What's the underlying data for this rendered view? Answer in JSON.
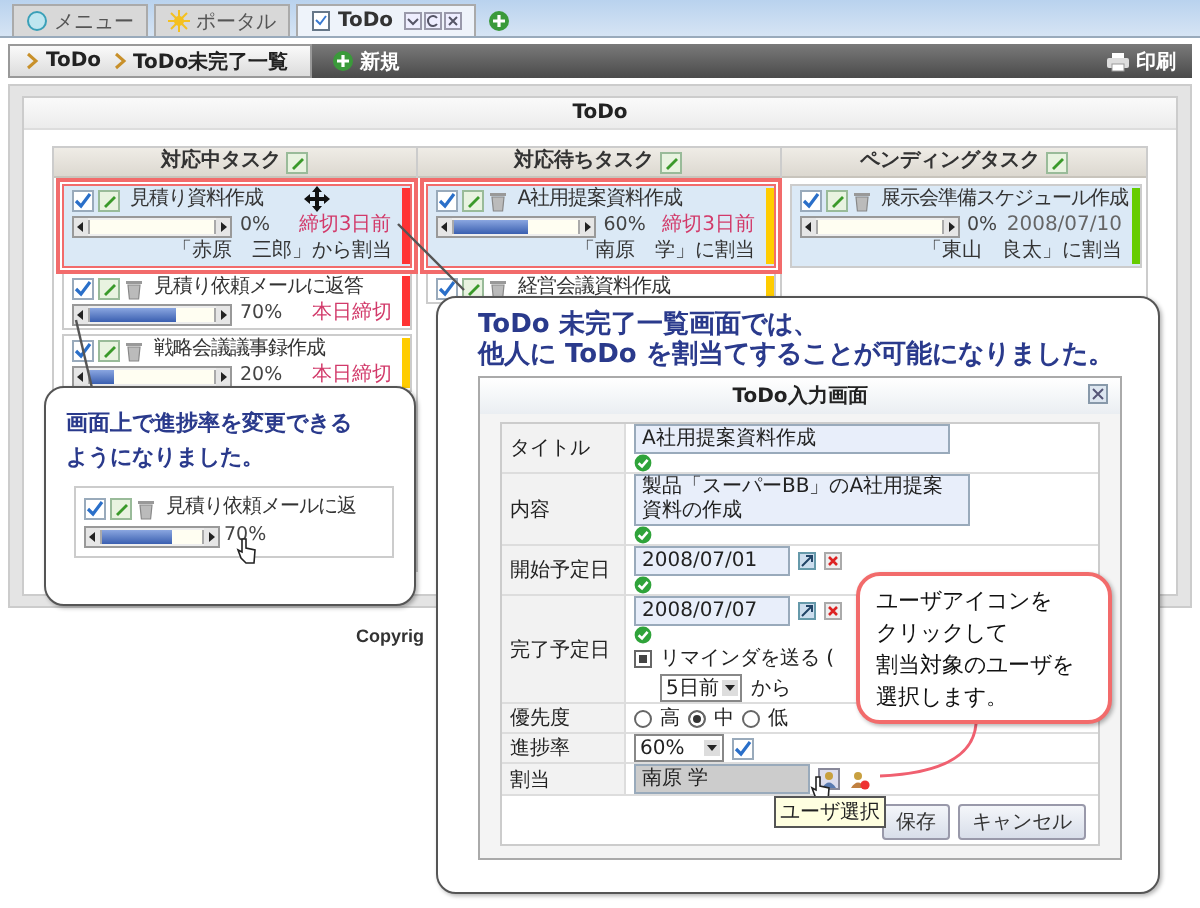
{
  "app_tabs": [
    {
      "label": "メニュー",
      "kind": "menu",
      "selected": false
    },
    {
      "label": "ポータル",
      "kind": "portal",
      "selected": false
    },
    {
      "label": "ToDo",
      "kind": "todo",
      "selected": true
    }
  ],
  "toolbar": {
    "breadcrumb": [
      "ToDo",
      "ToDo未完了一覧"
    ],
    "new_button": "新規",
    "print_button": "印刷"
  },
  "panel": {
    "title": "ToDo",
    "columns": [
      {
        "title": "対応中タスク",
        "tasks": [
          {
            "title": "見積り資料作成",
            "can_delete": false,
            "level": 0,
            "progress": "0%",
            "due": "締切3日前",
            "urgent": true,
            "assignment": "「赤原　三郎」から割当",
            "color": "#ff3333",
            "selected": true,
            "emphasized": true
          },
          {
            "title": "見積り依頼メールに返答",
            "can_delete": true,
            "level": 0.7,
            "progress": "70%",
            "due": "本日締切",
            "urgent": true,
            "color": "#ff3333",
            "selected": false,
            "emphasized": false
          },
          {
            "title": "戦略会議議事録作成",
            "can_delete": true,
            "level": 0.2,
            "progress": "20%",
            "due": "本日締切",
            "urgent": true,
            "color": "#ffcc00",
            "selected": false,
            "emphasized": false
          }
        ]
      },
      {
        "title": "対応待ちタスク",
        "tasks": [
          {
            "title": "A社用提案資料作成",
            "can_delete": true,
            "level": 0.6,
            "progress": "60%",
            "due": "締切3日前",
            "urgent": true,
            "assignment": "「南原　学」に割当",
            "color": "#ffcc00",
            "selected": true,
            "emphasized": true
          },
          {
            "title": "経営会議資料作成",
            "can_delete": true,
            "color": "#ffcc00",
            "selected": false,
            "emphasized": false
          }
        ]
      },
      {
        "title": "ペンディングタスク",
        "tasks": [
          {
            "title": "展示会準備スケジュール作成",
            "can_delete": true,
            "level": 0,
            "progress": "0%",
            "due": "2008/07/10",
            "urgent": false,
            "assignment": "「東山　良太」に割当",
            "color": "#66cc00",
            "selected": true,
            "emphasized": false
          }
        ]
      }
    ]
  },
  "footer": {
    "copyright": "Copyrig"
  },
  "callout_progress": {
    "lines": [
      "画面上で進捗率を変更できる",
      "ようになりました。"
    ],
    "sample": {
      "title": "見積り依頼メールに返",
      "level": 0.7,
      "progress": "70%"
    }
  },
  "callout_assign": {
    "lines": [
      "ToDo 未完了一覧画面では、",
      "他人に ToDo を割当てすることが可能になりました。"
    ],
    "dialog": {
      "title": "ToDo入力画面",
      "fields": [
        {
          "kind": "text",
          "label": "タイトル",
          "value": "A社用提案資料作成"
        },
        {
          "kind": "textarea",
          "label": "内容",
          "value": "製品「スーパーBB」のA社用提案資料の作成"
        },
        {
          "kind": "date",
          "label": "開始予定日",
          "value": "2008/07/01"
        },
        {
          "kind": "date",
          "label": "完了予定日",
          "value": "2008/07/07",
          "reminder": {
            "checked": true,
            "label": "リマインダを送る (",
            "select": "5日前",
            "suffix": "から"
          }
        },
        {
          "kind": "radio",
          "label": "優先度",
          "options": [
            {
              "label": "高",
              "selected": false
            },
            {
              "label": "中",
              "selected": true
            },
            {
              "label": "低",
              "selected": false
            }
          ]
        },
        {
          "kind": "select",
          "label": "進捗率",
          "value": "60%"
        },
        {
          "kind": "user",
          "label": "割当",
          "value": "南原 学",
          "tooltip": "ユーザ選択"
        }
      ],
      "buttons": [
        "保存",
        "キャンセル"
      ]
    }
  },
  "callout_user": {
    "lines": [
      "ユーザアイコンを",
      "クリックして",
      "割当対象のユーザを",
      "選択します。"
    ]
  }
}
